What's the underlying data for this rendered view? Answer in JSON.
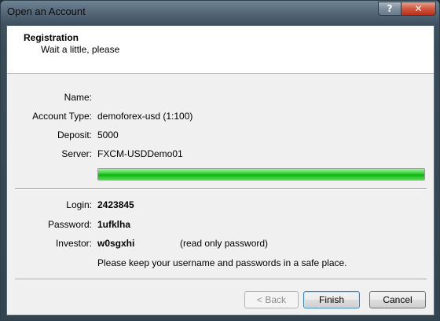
{
  "window": {
    "title": "Open an Account",
    "help_label": "?",
    "close_label": "✕"
  },
  "header": {
    "title": "Registration",
    "subtitle": "Wait a little, please"
  },
  "account": {
    "name_label": "Name:",
    "name_value": "",
    "type_label": "Account Type:",
    "type_value": "demoforex-usd (1:100)",
    "deposit_label": "Deposit:",
    "deposit_value": "5000",
    "server_label": "Server:",
    "server_value": "FXCM-USDDemo01"
  },
  "progress": {
    "fraction": 1.0,
    "color": "#22c022"
  },
  "credentials": {
    "login_label": "Login:",
    "login_value": "2423845",
    "password_label": "Password:",
    "password_value": "1ufklha",
    "investor_label": "Investor:",
    "investor_value": "w0sgxhi",
    "investor_note": "(read only password)",
    "note": "Please keep your username and passwords in a safe place."
  },
  "buttons": {
    "back": "< Back",
    "finish": "Finish",
    "cancel": "Cancel"
  }
}
